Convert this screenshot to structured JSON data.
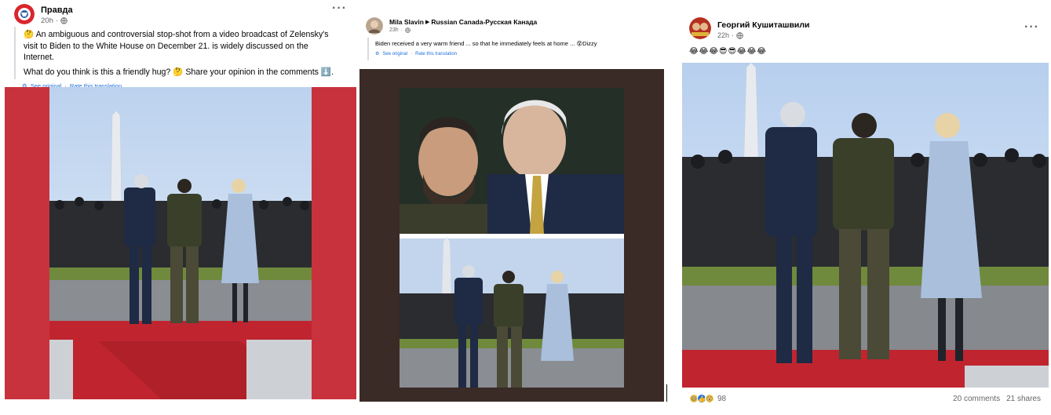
{
  "posts": [
    {
      "author": "Правда",
      "time": "20h",
      "text_1": "An ambiguous and controversial stop-shot from a video broadcast of Zelensky's visit to Biden to the White House on December 21. is widely discussed on the Internet.",
      "text_2": "What do you think is this a friendly hug? 🤔 Share your opinion in the comments ⬇️.",
      "lead_emoji": "🤔",
      "see_original": "See original",
      "separator": "·",
      "rate_translation": "Rate this translation",
      "more": "···"
    },
    {
      "author": "Mila Slavin",
      "group": "Russian Canada-Русская Канада",
      "time": "23h",
      "text": "Biden received a very warm friend ... so that he immediately feels at home ... 😵Dizzy",
      "see_original": "See original",
      "separator": "·",
      "rate_translation": "Rate this translation",
      "more": "···"
    },
    {
      "author": "Георгий Кушиташвили",
      "time": "22h",
      "text": "😂😂😂😎😎😂😂😂",
      "reaction_count": "98",
      "comments": "20 comments",
      "shares": "21 shares",
      "more": "···"
    }
  ],
  "icons": {
    "privacy": "globe-icon",
    "translate": "gear-icon",
    "reactions": [
      "haha-icon",
      "like-icon",
      "wow-icon"
    ]
  },
  "colors": {
    "red_carpet": "#c8323c",
    "link": "#216fdb",
    "muted": "#65676b",
    "collage_frame": "#3a2b27"
  }
}
